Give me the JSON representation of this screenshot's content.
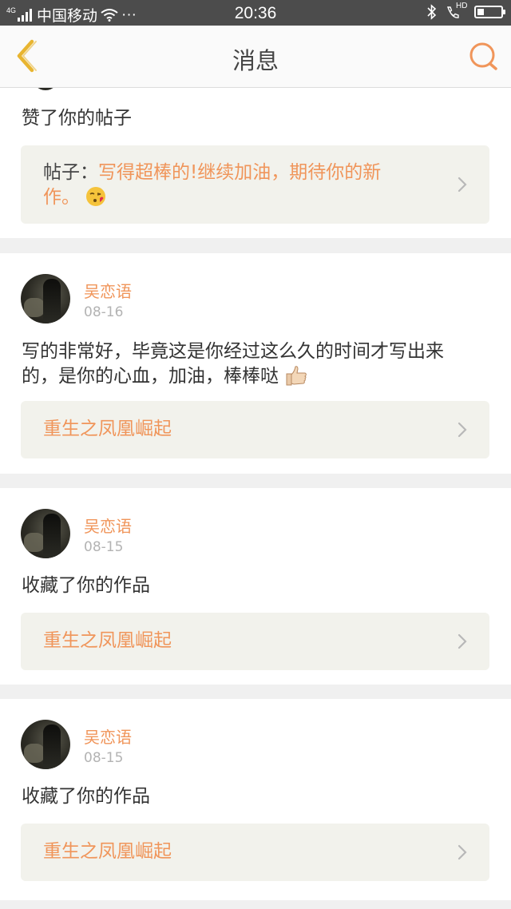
{
  "status_bar": {
    "network": "4G",
    "carrier": "中国移动",
    "more": "···",
    "time": "20:36",
    "signal_hd": "HD",
    "battery_level": 0.28
  },
  "header": {
    "title": "消息",
    "back_icon": "chevron-left-icon",
    "search_icon": "search-icon"
  },
  "top_card": {
    "message": "赞了你的帖子",
    "ref_prefix": "帖子：",
    "ref_text_line1": "写得超棒的!继续加油，期待你的新",
    "ref_text_line2": "作。",
    "ref_emoji": "kissing-face-emoji"
  },
  "cards": [
    {
      "user": "吴恋语",
      "date": "08-16",
      "message_line1": "写的非常好，毕竟这是你经过这么久的时间才写出来",
      "message_line2": "的，是你的心血，加油，棒棒哒",
      "message_emoji": "thumbs-up-emoji",
      "ref": "重生之凤凰崛起"
    },
    {
      "user": "吴恋语",
      "date": "08-15",
      "message_line1": "收藏了你的作品",
      "ref": "重生之凤凰崛起"
    },
    {
      "user": "吴恋语",
      "date": "08-15",
      "message_line1": "收藏了你的作品",
      "ref": "重生之凤凰崛起"
    }
  ],
  "colors": {
    "accent": "#f0955a",
    "back_icon": "#e8b530",
    "ref_bg": "#f2f2ec",
    "page_bg": "#f0f0f0"
  }
}
